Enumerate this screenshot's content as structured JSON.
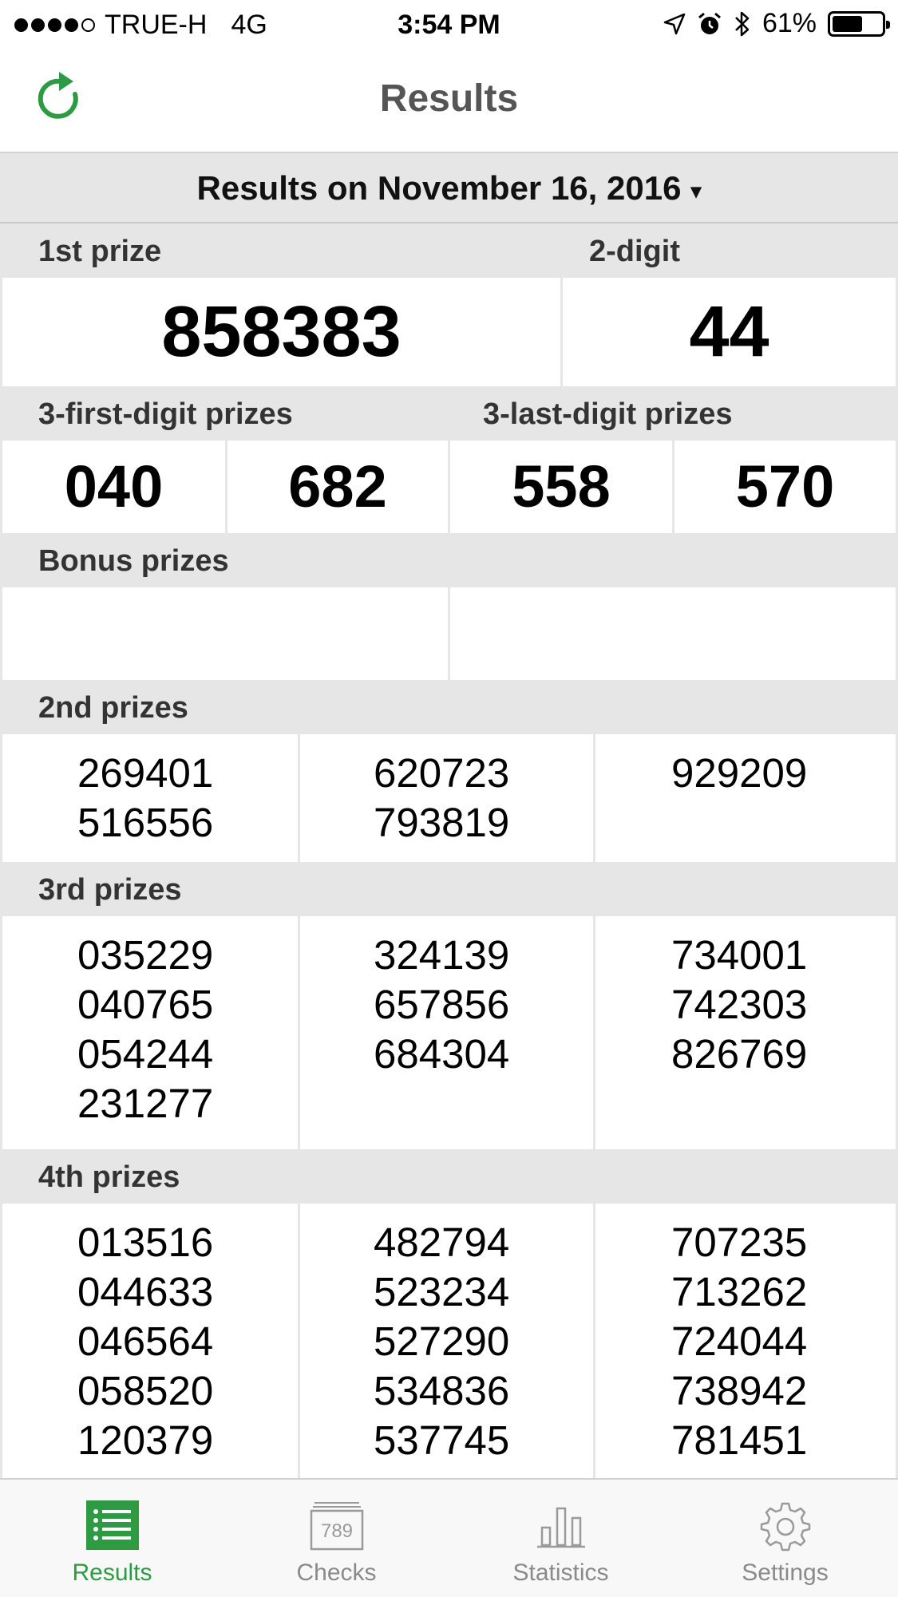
{
  "status_bar": {
    "carrier": "TRUE-H",
    "network": "4G",
    "time": "3:54 PM",
    "battery": "61%",
    "battery_level": 0.61
  },
  "nav": {
    "title": "Results"
  },
  "date_header": {
    "label": "Results on November 16, 2016",
    "caret": "▾"
  },
  "first_prize": {
    "label": "1st prize",
    "value": "858383"
  },
  "two_digit": {
    "label": "2-digit",
    "value": "44"
  },
  "three_first": {
    "label": "3-first-digit prizes",
    "values": [
      "040",
      "682"
    ]
  },
  "three_last": {
    "label": "3-last-digit prizes",
    "values": [
      "558",
      "570"
    ]
  },
  "bonus": {
    "label": "Bonus prizes"
  },
  "second_prizes": {
    "label": "2nd prizes",
    "columns": [
      [
        "269401",
        "516556"
      ],
      [
        "620723",
        "793819"
      ],
      [
        "929209"
      ]
    ]
  },
  "third_prizes": {
    "label": "3rd prizes",
    "columns": [
      [
        "035229",
        "040765",
        "054244",
        "231277"
      ],
      [
        "324139",
        "657856",
        "684304"
      ],
      [
        "734001",
        "742303",
        "826769"
      ]
    ]
  },
  "fourth_prizes": {
    "label": "4th prizes",
    "columns": [
      [
        "013516",
        "044633",
        "046564",
        "058520",
        "120379"
      ],
      [
        "482794",
        "523234",
        "527290",
        "534836",
        "537745"
      ],
      [
        "707235",
        "713262",
        "724044",
        "738942",
        "781451"
      ]
    ]
  },
  "tabs": [
    {
      "label": "Results",
      "icon": "list-icon",
      "active": true
    },
    {
      "label": "Checks",
      "icon": "ticket-icon",
      "badge": "789"
    },
    {
      "label": "Statistics",
      "icon": "bar-chart-icon"
    },
    {
      "label": "Settings",
      "icon": "gear-icon"
    }
  ],
  "colors": {
    "accent": "#2e9a44",
    "section_bg": "#e6e6e6",
    "inactive_tab": "#8a8a8a"
  }
}
